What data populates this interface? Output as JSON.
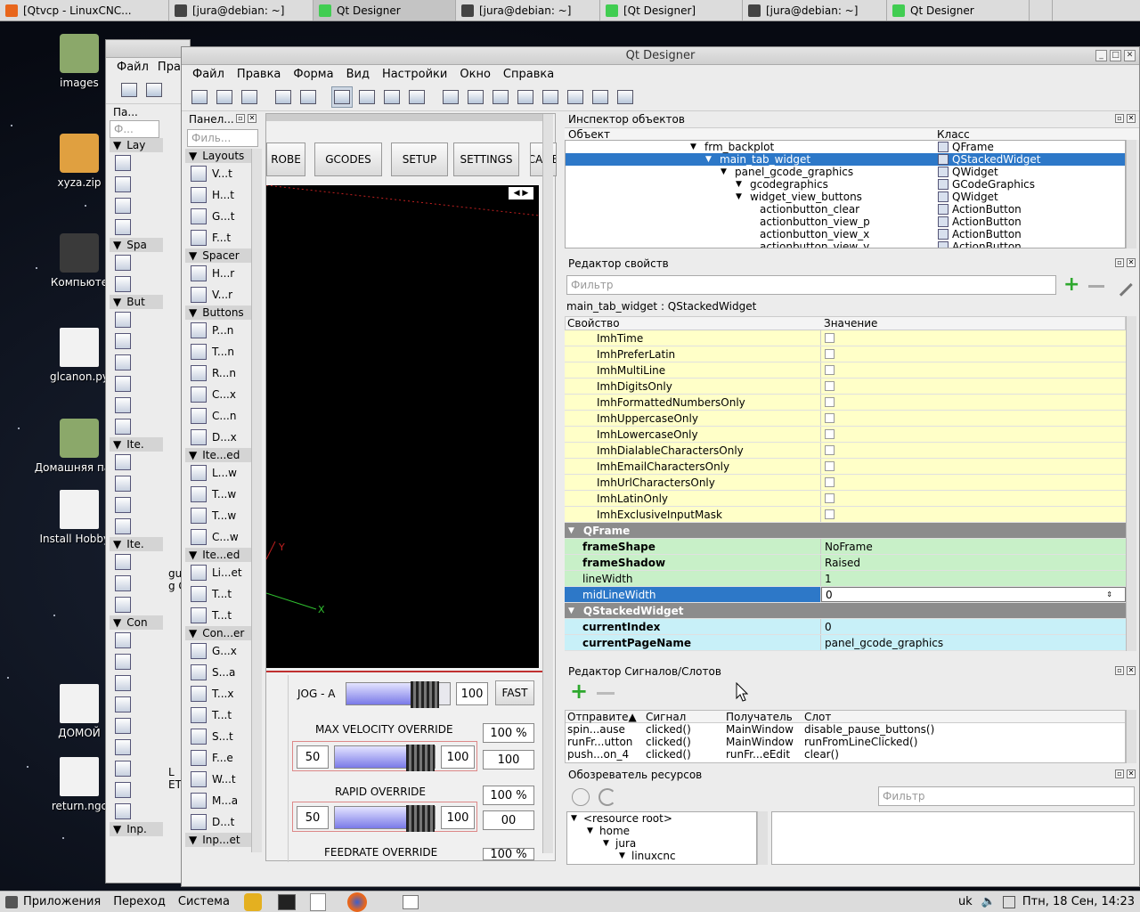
{
  "taskbar": {
    "tasks": [
      {
        "label": "[Qtvcp - LinuxCNC...",
        "icon": "firefox-icon",
        "color": "#e8661c"
      },
      {
        "label": "[jura@debian: ~]",
        "icon": "terminal-icon",
        "color": "#444444"
      },
      {
        "label": "Qt Designer",
        "icon": "qt-icon",
        "color": "#41cd52"
      },
      {
        "label": "[jura@debian: ~]",
        "icon": "terminal-icon",
        "color": "#444444"
      },
      {
        "label": "[Qt Designer]",
        "icon": "qt-icon",
        "color": "#41cd52"
      },
      {
        "label": "[jura@debian: ~]",
        "icon": "terminal-icon",
        "color": "#444444"
      },
      {
        "label": "Qt Designer",
        "icon": "qt-icon",
        "color": "#41cd52"
      }
    ]
  },
  "desktop": {
    "icons": [
      {
        "label": "images",
        "icon": "folder-icon"
      },
      {
        "label": "xyza.zip",
        "icon": "archive-icon"
      },
      {
        "label": "Компьюте",
        "icon": "computer-icon"
      },
      {
        "label": "glcanon.py",
        "icon": "file-icon"
      },
      {
        "label": "Домашняя папк",
        "icon": "home-folder-icon"
      },
      {
        "label": "Install HobbyM",
        "icon": "file-icon"
      },
      {
        "label": "ДОМОЙ",
        "icon": "file-icon"
      },
      {
        "label": "return.ngc",
        "icon": "file-icon"
      }
    ]
  },
  "backwin": {
    "menu": [
      "Файл",
      "Прав"
    ],
    "panel_title": "Па...",
    "filter": "Ф...",
    "cats": [
      "Lay",
      "Spa",
      "But",
      "Ite.",
      "Ite.",
      "Con",
      "Inp."
    ],
    "frag1": "gu",
    "frag2": "g C",
    "frag3": "L",
    "frag4": "ETS"
  },
  "main": {
    "title": "Qt Designer",
    "menu": [
      "Файл",
      "Правка",
      "Форма",
      "Вид",
      "Настройки",
      "Окно",
      "Справка"
    ],
    "widgetbox": {
      "title": "Панел...",
      "filter": "Филь...",
      "categories": [
        {
          "name": "Layouts",
          "items": [
            "V...t",
            "H...t",
            "G...t",
            "F...t"
          ]
        },
        {
          "name": "Spacer",
          "items": [
            "H...r",
            "V...r"
          ]
        },
        {
          "name": "Buttons",
          "items": [
            "P...n",
            "T...n",
            "R...n",
            "C...x",
            "C...n",
            "D...x"
          ]
        },
        {
          "name": "Ite...ed",
          "items": [
            "L...w",
            "T...w",
            "T...w",
            "C...w"
          ]
        },
        {
          "name": "Ite...ed",
          "items": [
            "Li...et",
            "T...t",
            "T...t"
          ]
        },
        {
          "name": "Con...er",
          "items": [
            "G...x",
            "S...a",
            "T...x",
            "T...t",
            "S...t",
            "F...e",
            "W...t",
            "M...a",
            "D...t"
          ]
        },
        {
          "name": "Inp...et",
          "items": []
        }
      ]
    },
    "form": {
      "tabs": [
        "ROBE",
        "GCODES",
        "SETUP",
        "SETTINGS",
        "CAME"
      ],
      "jog_label": "JOG - A",
      "jog_value": "100",
      "fast_label": "FAST",
      "maxvel_label": "MAX VELOCITY OVERRIDE",
      "maxvel_pct": "100 %",
      "maxvel_min": "50",
      "maxvel_max": "100",
      "maxvel_box": "100",
      "rapid_label": "RAPID OVERRIDE",
      "rapid_pct": "100 %",
      "rapid_min": "50",
      "rapid_max": "100",
      "rapid_box": "00",
      "feed_label": "FEEDRATE OVERRIDE",
      "feed_pct": "100 %",
      "axis_y": "Y",
      "axis_x": "X"
    },
    "inspector": {
      "title": "Инспектор объектов",
      "col_object": "Объект",
      "col_class": "Класс",
      "rows": [
        {
          "name": "frm_backplot",
          "cls": "QFrame",
          "depth": 0,
          "sel": false
        },
        {
          "name": "main_tab_widget",
          "cls": "QStackedWidget",
          "depth": 1,
          "sel": true
        },
        {
          "name": "panel_gcode_graphics",
          "cls": "QWidget",
          "depth": 2,
          "sel": false
        },
        {
          "name": "gcodegraphics",
          "cls": "GCodeGraphics",
          "depth": 3,
          "sel": false
        },
        {
          "name": "widget_view_buttons",
          "cls": "QWidget",
          "depth": 3,
          "sel": false
        },
        {
          "name": "actionbutton_clear",
          "cls": "ActionButton",
          "depth": 4,
          "sel": false
        },
        {
          "name": "actionbutton_view_p",
          "cls": "ActionButton",
          "depth": 4,
          "sel": false
        },
        {
          "name": "actionbutton_view_x",
          "cls": "ActionButton",
          "depth": 4,
          "sel": false
        },
        {
          "name": "actionbutton_view_y",
          "cls": "ActionButton",
          "depth": 4,
          "sel": false
        }
      ]
    },
    "props": {
      "title": "Редактор свойств",
      "filter": "Фильтр",
      "object": "main_tab_widget : QStackedWidget",
      "col_prop": "Свойство",
      "col_val": "Значение",
      "rows": [
        {
          "n": "ImhTime",
          "v": "",
          "t": "y"
        },
        {
          "n": "ImhPreferLatin",
          "v": "",
          "t": "y"
        },
        {
          "n": "ImhMultiLine",
          "v": "",
          "t": "y"
        },
        {
          "n": "ImhDigitsOnly",
          "v": "",
          "t": "y"
        },
        {
          "n": "ImhFormattedNumbersOnly",
          "v": "",
          "t": "y"
        },
        {
          "n": "ImhUppercaseOnly",
          "v": "",
          "t": "y"
        },
        {
          "n": "ImhLowercaseOnly",
          "v": "",
          "t": "y"
        },
        {
          "n": "ImhDialableCharactersOnly",
          "v": "",
          "t": "y"
        },
        {
          "n": "ImhEmailCharactersOnly",
          "v": "",
          "t": "y"
        },
        {
          "n": "ImhUrlCharactersOnly",
          "v": "",
          "t": "y"
        },
        {
          "n": "ImhLatinOnly",
          "v": "",
          "t": "y"
        },
        {
          "n": "ImhExclusiveInputMask",
          "v": "",
          "t": "y"
        },
        {
          "n": "QFrame",
          "v": "",
          "t": "h"
        },
        {
          "n": "frameShape",
          "v": "NoFrame",
          "t": "g",
          "b": true
        },
        {
          "n": "frameShadow",
          "v": "Raised",
          "t": "g",
          "b": true
        },
        {
          "n": "lineWidth",
          "v": "1",
          "t": "g"
        },
        {
          "n": "midLineWidth",
          "v": "0",
          "t": "s"
        },
        {
          "n": "QStackedWidget",
          "v": "",
          "t": "h"
        },
        {
          "n": "currentIndex",
          "v": "0",
          "t": "c",
          "b": true
        },
        {
          "n": "currentPageName",
          "v": "panel_gcode_graphics",
          "t": "c",
          "b": true
        }
      ]
    },
    "signals": {
      "title": "Редактор Сигналов/Слотов",
      "cols": [
        "Отправите▲",
        "Сигнал",
        "Получатель",
        "Слот"
      ],
      "rows": [
        [
          "spin...ause",
          "clicked()",
          "MainWindow",
          "disable_pause_buttons()"
        ],
        [
          "runFr...utton",
          "clicked()",
          "MainWindow",
          "runFromLineClicked()"
        ],
        [
          "push...on_4",
          "clicked()",
          "runFr...eEdit",
          "clear()"
        ]
      ]
    },
    "resources": {
      "title": "Обозреватель ресурсов",
      "filter": "Фильтр",
      "tree": [
        "<resource root>",
        "home",
        "jura",
        "linuxcnc"
      ]
    }
  },
  "panel": {
    "menus": [
      "Приложения",
      "Переход",
      "Система"
    ],
    "layout": "uk",
    "clock": "Птн, 18 Сен, 14:23"
  },
  "colors": {
    "selection": "#2d78c8",
    "qt_green": "#41cd52"
  }
}
